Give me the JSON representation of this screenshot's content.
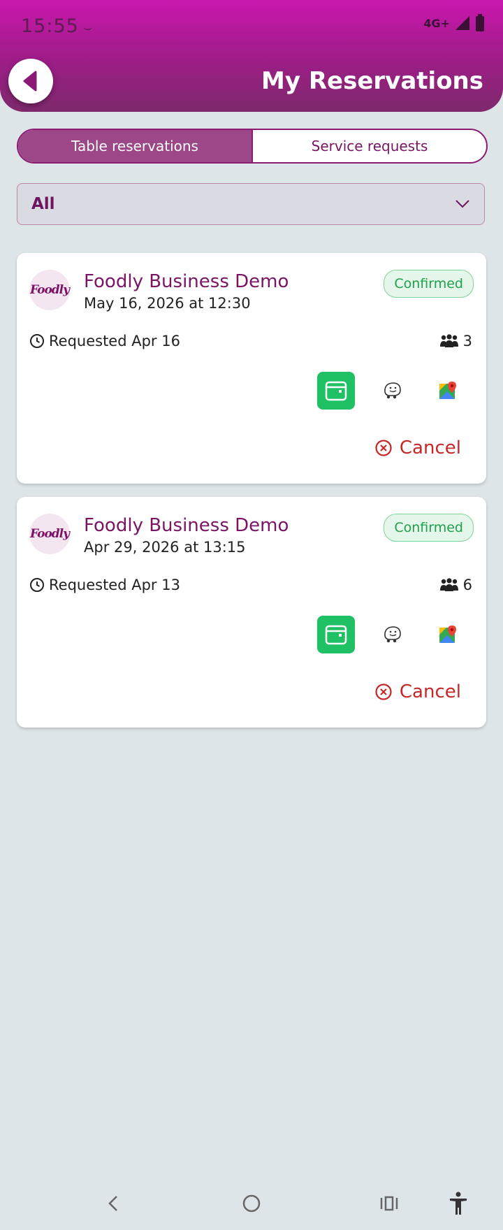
{
  "status_bar": {
    "time": "15:55",
    "network": "4G+"
  },
  "header": {
    "title": "My Reservations"
  },
  "tabs": [
    {
      "label": "Table reservations",
      "active": true
    },
    {
      "label": "Service requests",
      "active": false
    }
  ],
  "filter": {
    "value": "All"
  },
  "reservations": [
    {
      "logo_text": "Foodly",
      "business": "Foodly Business Demo",
      "datetime": "May 16, 2026 at 12:30",
      "status": "Confirmed",
      "requested": "Requested Apr 16",
      "party_size": "3",
      "cancel_label": "Cancel"
    },
    {
      "logo_text": "Foodly",
      "business": "Foodly Business Demo",
      "datetime": "Apr 29, 2026 at 13:15",
      "status": "Confirmed",
      "requested": "Requested Apr 13",
      "party_size": "6",
      "cancel_label": "Cancel"
    }
  ],
  "colors": {
    "brand": "#9c1d86",
    "confirmed": "#1fa04c",
    "cancel": "#c62828",
    "calendar_button": "#20c065"
  }
}
